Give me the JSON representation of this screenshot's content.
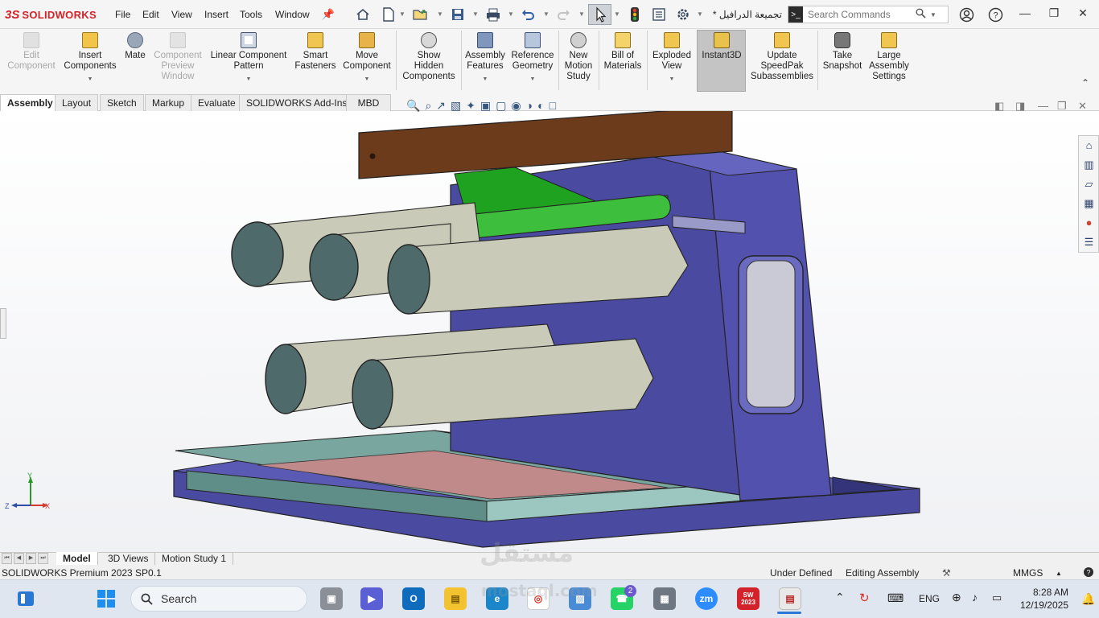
{
  "app": {
    "brand": "SOLIDWORKS",
    "ds_mark": "3S"
  },
  "menu": [
    "File",
    "Edit",
    "View",
    "Insert",
    "Tools",
    "Window"
  ],
  "document_title": "* تجميعة الدرافيل",
  "search": {
    "placeholder": "Search Commands"
  },
  "commands": [
    {
      "label": "Edit Component",
      "lines": [
        "Edit",
        "Component"
      ],
      "disabled": true,
      "icon": "edit-component-icon"
    },
    {
      "label": "Insert Components",
      "lines": [
        "Insert",
        "Components"
      ],
      "disabled": false,
      "icon": "insert-components-icon"
    },
    {
      "label": "Mate",
      "lines": [
        "Mate"
      ],
      "disabled": false,
      "icon": "mate-icon"
    },
    {
      "label": "Component Preview Window",
      "lines": [
        "Component",
        "Preview",
        "Window"
      ],
      "disabled": true,
      "icon": "component-preview-icon"
    },
    {
      "label": "Linear Component Pattern",
      "lines": [
        "Linear Component",
        "Pattern"
      ],
      "disabled": false,
      "icon": "linear-pattern-icon"
    },
    {
      "label": "Smart Fasteners",
      "lines": [
        "Smart",
        "Fasteners"
      ],
      "disabled": false,
      "icon": "smart-fasteners-icon"
    },
    {
      "label": "Move Component",
      "lines": [
        "Move",
        "Component"
      ],
      "disabled": false,
      "icon": "move-component-icon"
    },
    {
      "label": "Show Hidden Components",
      "lines": [
        "Show",
        "Hidden",
        "Components"
      ],
      "disabled": false,
      "icon": "show-hidden-icon"
    },
    {
      "label": "Assembly Features",
      "lines": [
        "Assembly",
        "Features"
      ],
      "disabled": false,
      "icon": "assembly-features-icon"
    },
    {
      "label": "Reference Geometry",
      "lines": [
        "Reference",
        "Geometry"
      ],
      "disabled": false,
      "icon": "reference-geometry-icon"
    },
    {
      "label": "New Motion Study",
      "lines": [
        "New",
        "Motion",
        "Study"
      ],
      "disabled": false,
      "icon": "motion-study-icon"
    },
    {
      "label": "Bill of Materials",
      "lines": [
        "Bill of",
        "Materials"
      ],
      "disabled": false,
      "icon": "bill-of-materials-icon"
    },
    {
      "label": "Exploded View",
      "lines": [
        "Exploded",
        "View"
      ],
      "disabled": false,
      "icon": "exploded-view-icon"
    },
    {
      "label": "Instant3D",
      "lines": [
        "Instant3D"
      ],
      "disabled": false,
      "icon": "instant3d-icon",
      "active": true
    },
    {
      "label": "Update SpeedPak Subassemblies",
      "lines": [
        "Update",
        "SpeedPak",
        "Subassemblies"
      ],
      "disabled": false,
      "icon": "speedpak-icon"
    },
    {
      "label": "Take Snapshot",
      "lines": [
        "Take",
        "Snapshot"
      ],
      "disabled": false,
      "icon": "snapshot-icon"
    },
    {
      "label": "Large Assembly Settings",
      "lines": [
        "Large",
        "Assembly",
        "Settings"
      ],
      "disabled": false,
      "icon": "large-assembly-icon"
    }
  ],
  "tabs": [
    "Assembly",
    "Layout",
    "Sketch",
    "Markup",
    "Evaluate",
    "SOLIDWORKS Add-Ins",
    "MBD"
  ],
  "active_tab": "Assembly",
  "triad": {
    "x": "X",
    "y": "Y",
    "z": "Z"
  },
  "bottom_tabs": [
    "Model",
    "3D Views",
    "Motion Study 1"
  ],
  "active_bottom_tab": "Model",
  "status": {
    "product": "SOLIDWORKS Premium 2023 SP0.1",
    "definition": "Under Defined",
    "mode": "Editing Assembly",
    "units": "MMGS"
  },
  "taskbar": {
    "search_label": "Search",
    "language": "ENG",
    "time": "8:28 AM",
    "date": "12/19/2025",
    "whatsapp_badge": "2",
    "solidworks_badge": "2023"
  },
  "watermark": {
    "arabic": "مستقل",
    "latin": "mostaql.com"
  },
  "colors": {
    "brand_red": "#d2232a",
    "base_plate": "#4a4aa0",
    "tray_teal": "#6e9f97",
    "tray_floor": "#c08a8a",
    "upright": "#5050a8",
    "roller": "#c9cab8",
    "roller_end": "#4f6a6a",
    "beam": "#6b3b1c",
    "bracket": "#1fa21f"
  }
}
